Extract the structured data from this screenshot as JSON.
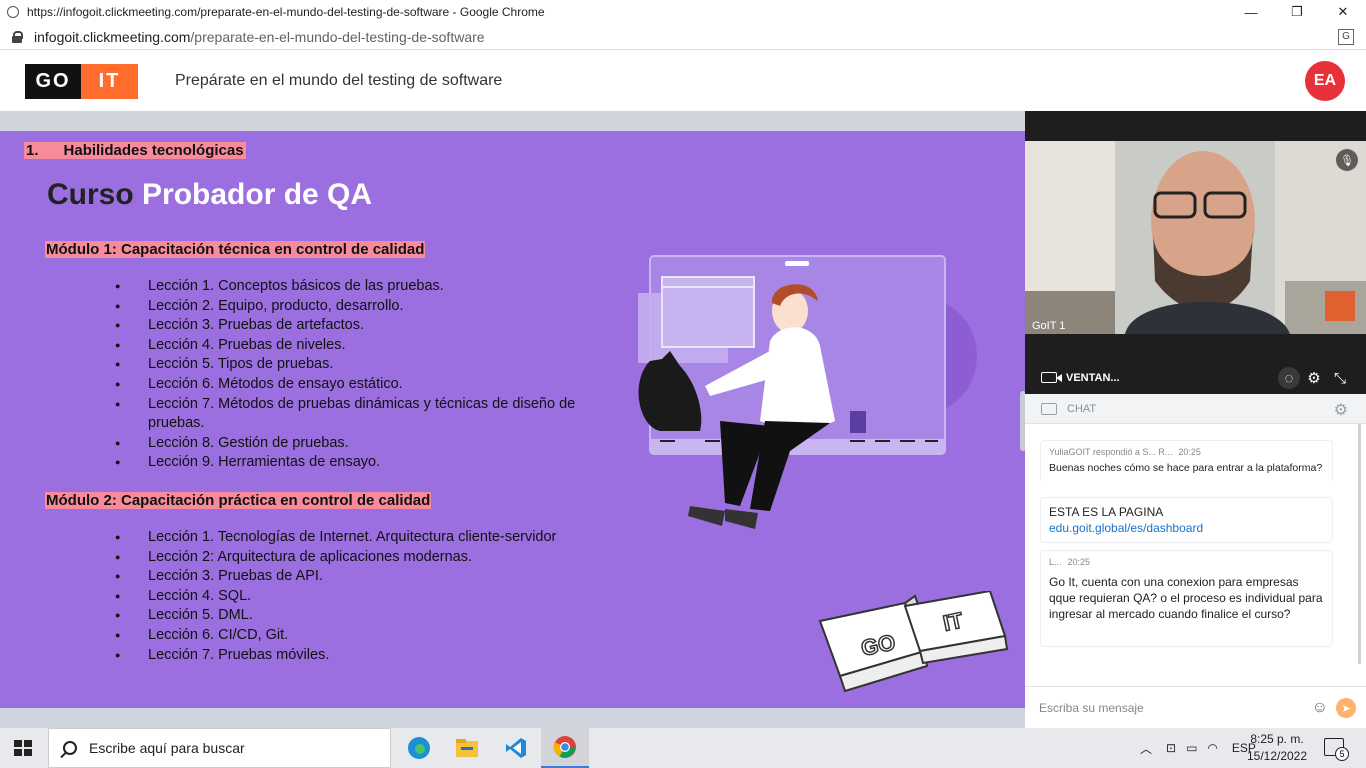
{
  "browser": {
    "window_title": "https://infogoit.clickmeeting.com/preparate-en-el-mundo-del-testing-de-software - Google Chrome",
    "url_host": "infogoit.clickmeeting.com",
    "url_path": "/preparate-en-el-mundo-del-testing-de-software",
    "controls": {
      "minimize": "—",
      "restore": "❐",
      "close": "✕"
    }
  },
  "header": {
    "logo_left": "GO",
    "logo_right": "IT",
    "title": "Prepárate en el mundo del testing de software",
    "avatar_initials": "EA"
  },
  "slide": {
    "section": "1.      Habilidades tecnológicas",
    "heading_part1": "Curso",
    "heading_part2": "Probador de QA",
    "module1": {
      "title": "Módulo 1: Capacitación técnica en control de calidad",
      "lessons": [
        "Lección 1. Conceptos básicos de las pruebas.",
        "Lección 2. Equipo, producto, desarrollo.",
        "Lección 3. Pruebas de artefactos.",
        "Lección 4. Pruebas de niveles.",
        "Lección 5. Tipos de pruebas.",
        "Lección 6. Métodos de ensayo estático.",
        "Lección 7. Métodos de pruebas dinámicas y técnicas de diseño de pruebas.",
        "Lección 8. Gestión de pruebas.",
        "Lección 9. Herramientas de ensayo."
      ]
    },
    "module2": {
      "title": "Módulo 2: Capacitación práctica en control de calidad",
      "lessons": [
        "Lección 1. Tecnologías de Internet. Arquitectura cliente-servidor",
        "Lección 2: Arquitectura de aplicaciones modernas.",
        "Lección 3. Pruebas de API.",
        "Lección 4. SQL.",
        "Lección 5. DML.",
        "Lección 6. CI/CD, Git.",
        "Lección 7. Pruebas móviles."
      ]
    },
    "cube_left": "GO",
    "cube_right": "IT"
  },
  "video": {
    "participant_label": "GoIT 1",
    "window_label": "VENTAN..."
  },
  "chat": {
    "title": "CHAT",
    "messages": [
      {
        "author": "YuliaGOIT respondió a S... R...",
        "time": "20:25",
        "quote": "Buenas noches cómo se hace para entrar a la plataforma?",
        "body": "ESTA ES LA PAGINA",
        "link": "edu.goit.global/es/dashboard"
      },
      {
        "author": "L...",
        "time": "20:25",
        "body": "Go It, cuenta con una conexion para empresas qque requieran QA? o el proceso es individual para ingresar al mercado cuando finalice el curso?"
      }
    ],
    "input_placeholder": "Escriba su mensaje"
  },
  "taskbar": {
    "search_placeholder": "Escribe aquí para buscar",
    "language": "ESP",
    "time": "8:25 p. m.",
    "date": "15/12/2022",
    "notification_count": "5"
  },
  "colors": {
    "slide_bg": "#9b6fdf",
    "highlight": "#f78a9b",
    "brand_orange": "#ff6c2c",
    "avatar_red": "#e8303a"
  }
}
